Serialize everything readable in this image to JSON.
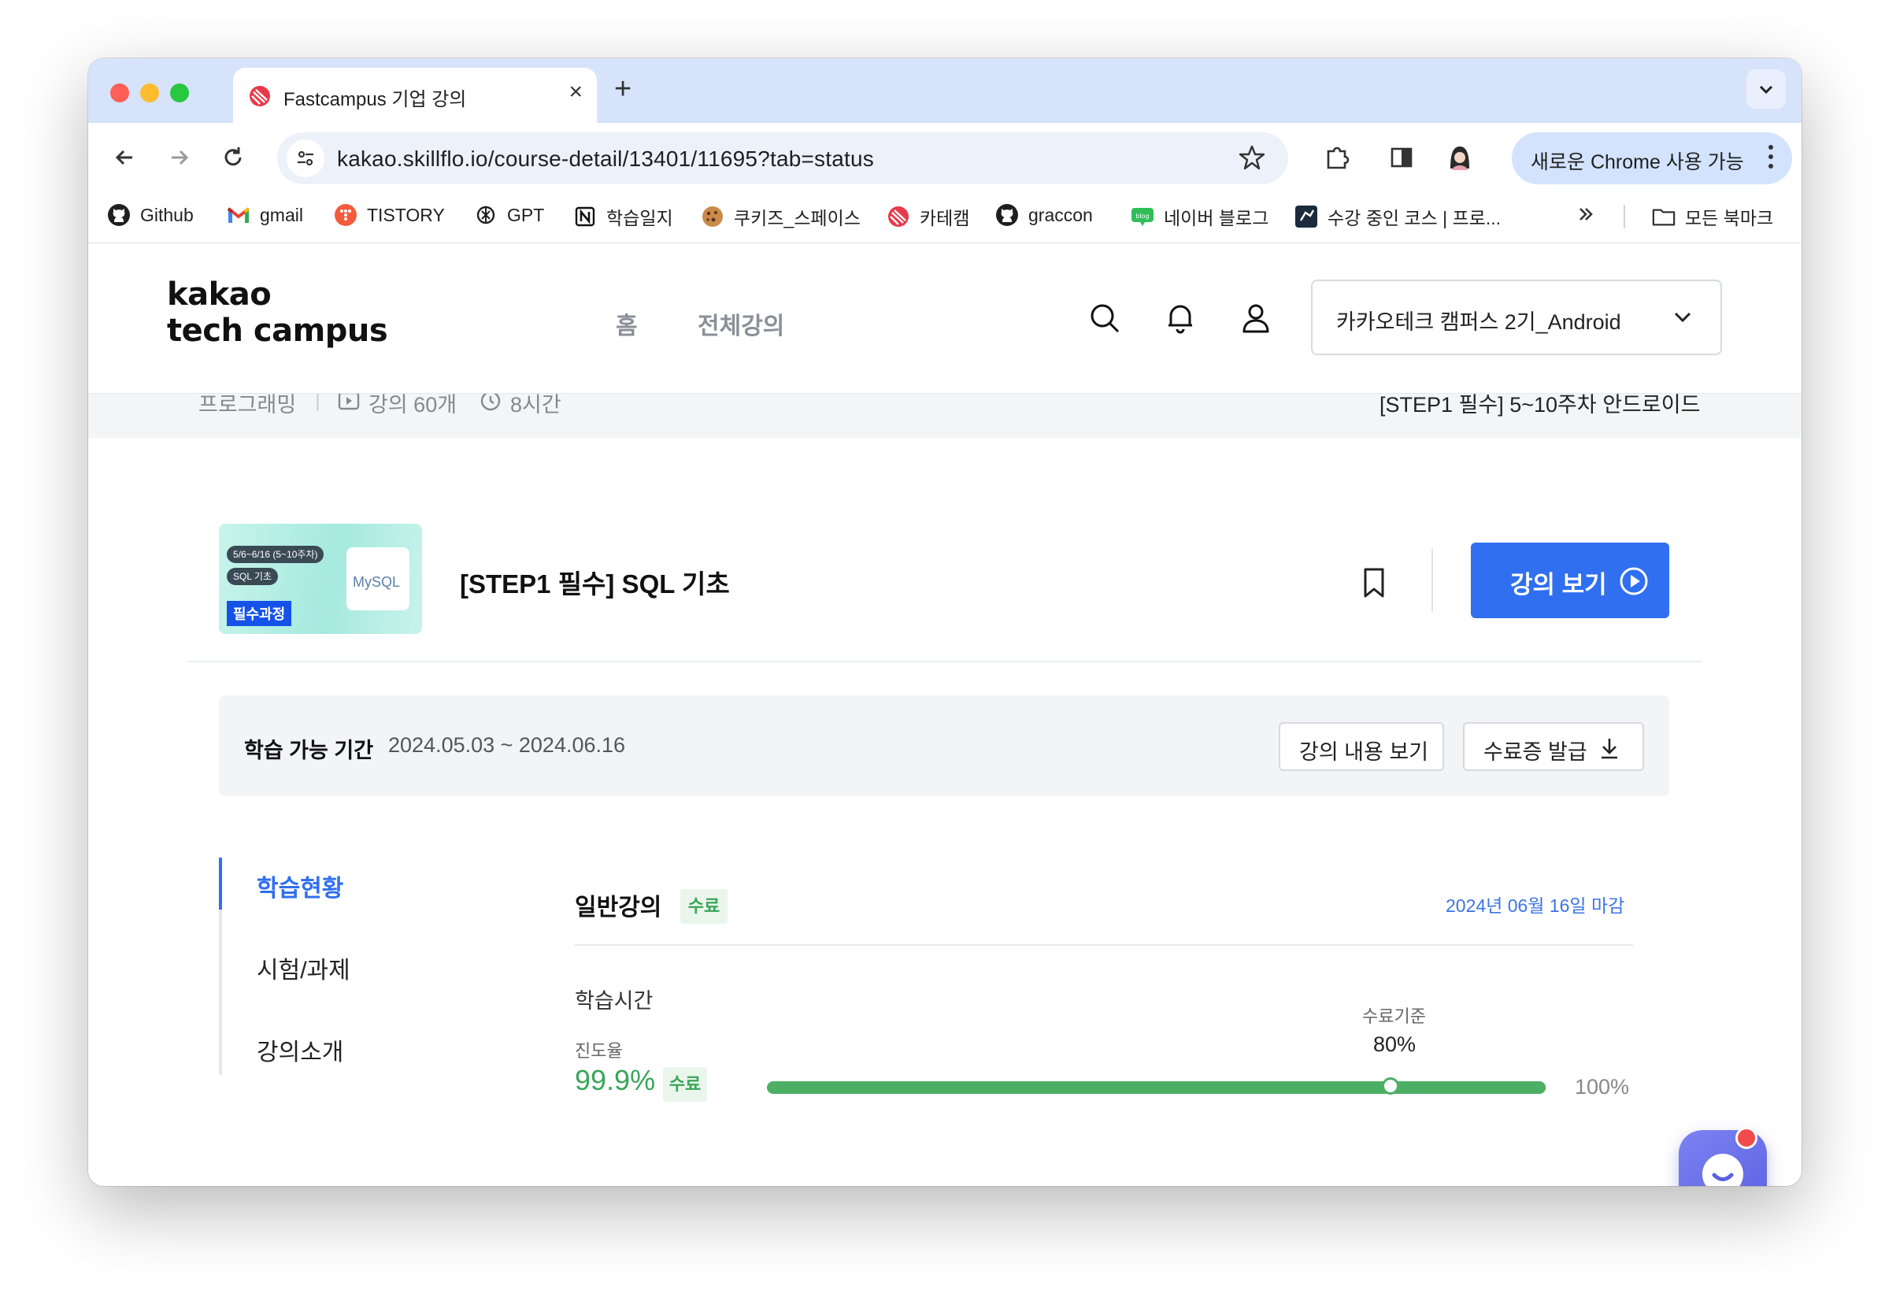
{
  "browser": {
    "tab_title": "Fastcampus 기업 강의",
    "url": "kakao.skillflo.io/course-detail/13401/11695?tab=status",
    "new_chrome_label": "새로운 Chrome 사용 가능",
    "bookmarks": [
      {
        "label": "Github",
        "icon": "github-icon"
      },
      {
        "label": "gmail",
        "icon": "gmail-icon"
      },
      {
        "label": "TISTORY",
        "icon": "tistory-icon"
      },
      {
        "label": "GPT",
        "icon": "openai-icon"
      },
      {
        "label": "학습일지",
        "icon": "notion-icon"
      },
      {
        "label": "쿠키즈_스페이스",
        "icon": "cookie-icon"
      },
      {
        "label": "카테캠",
        "icon": "fastcampus-icon"
      },
      {
        "label": "graccon",
        "icon": "github-icon"
      },
      {
        "label": "네이버 블로그",
        "icon": "naver-blog-icon"
      },
      {
        "label": "수강 중인 코스 | 프로...",
        "icon": "programmers-icon"
      }
    ],
    "all_bookmarks_label": "모든 북마크"
  },
  "site": {
    "logo_line1": "kakao",
    "logo_line2": "tech campus",
    "nav": [
      "홈",
      "전체강의"
    ],
    "campus_select": "카카오테크 캠퍼스 2기_Android"
  },
  "info_strip": {
    "category": "프로그래밍",
    "lecture_count": "강의 60개",
    "duration": "8시간",
    "right_text": "[STEP1 필수] 5~10주차 안드로이드"
  },
  "course": {
    "thumb_pill1": "5/6~6/16 (5~10주차)",
    "thumb_pill2": "SQL 기초",
    "thumb_must": "필수과정",
    "thumb_logo": "MySQL",
    "title": "[STEP1 필수] SQL 기초",
    "watch_label": "강의 보기"
  },
  "period": {
    "label": "학습 가능 기간",
    "value": "2024.05.03 ~ 2024.06.16",
    "content_btn": "강의 내용 보기",
    "cert_btn": "수료증 발급"
  },
  "left_tabs": [
    "학습현황",
    "시험/과제",
    "강의소개"
  ],
  "status": {
    "section_title": "일반강의",
    "section_badge": "수료",
    "deadline": "2024년 06월 16일 마감",
    "study_time_label": "학습시간",
    "criteria_label": "수료기준",
    "criteria_value": "80%",
    "criteria_fraction": 0.8,
    "progress_label": "진도율",
    "progress_value": "99.9%",
    "progress_fraction": 0.999,
    "progress_badge": "수료",
    "max_label": "100%"
  },
  "colors": {
    "accent_blue": "#2f6ff0",
    "complete_green": "#4caf65",
    "tab_strip": "#d7e3fb"
  }
}
